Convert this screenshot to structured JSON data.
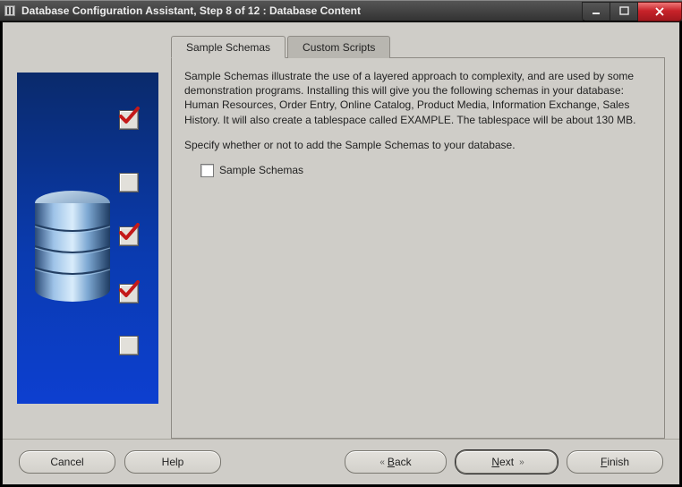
{
  "window": {
    "title": "Database Configuration Assistant, Step 8 of 12 : Database Content"
  },
  "tabs": {
    "sample_schemas": "Sample Schemas",
    "custom_scripts": "Custom Scripts"
  },
  "content": {
    "description": "Sample Schemas illustrate the use of a layered approach to complexity, and are used by some demonstration programs. Installing this will give you the following schemas in your database: Human Resources, Order Entry, Online Catalog, Product Media, Information Exchange, Sales History. It will also create a tablespace called EXAMPLE. The tablespace will be about 130 MB.",
    "instruction": "Specify whether or not to add the Sample Schemas to your database.",
    "checkbox_label": "Sample Schemas",
    "checkbox_checked": false
  },
  "illustration": {
    "steps": [
      true,
      false,
      true,
      true,
      false
    ]
  },
  "buttons": {
    "cancel": "Cancel",
    "help": "Help",
    "back": "Back",
    "next": "Next",
    "finish": "Finish"
  }
}
